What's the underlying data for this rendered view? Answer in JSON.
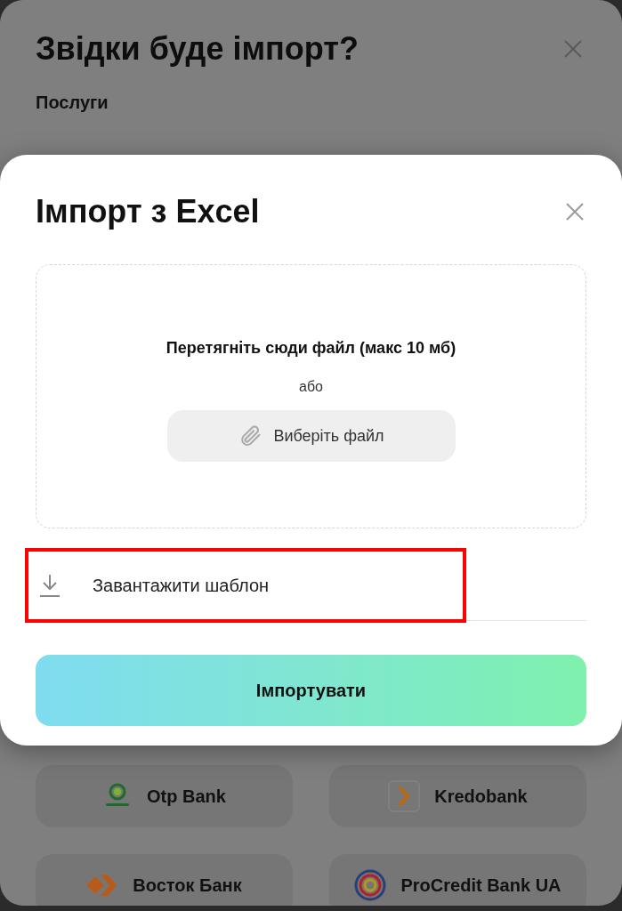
{
  "back_sheet": {
    "title": "Звідки буде імпорт?",
    "section": "Послуги",
    "banks": [
      {
        "name": "Otp Bank",
        "kind": "otp"
      },
      {
        "name": "Kredobank",
        "kind": "kredo"
      },
      {
        "name": "Восток Банк",
        "kind": "vostok"
      },
      {
        "name": "ProCredit Bank UA",
        "kind": "procredit"
      }
    ]
  },
  "modal": {
    "title": "Імпорт з Excel",
    "dropzone": {
      "hint": "Перетягніть сюди файл (макс 10 мб)",
      "or": "або",
      "choose_button": "Виберіть файл"
    },
    "template_link": {
      "label": "Завантажити шаблон",
      "highlighted": true
    },
    "import_button": "Імпортувати"
  }
}
